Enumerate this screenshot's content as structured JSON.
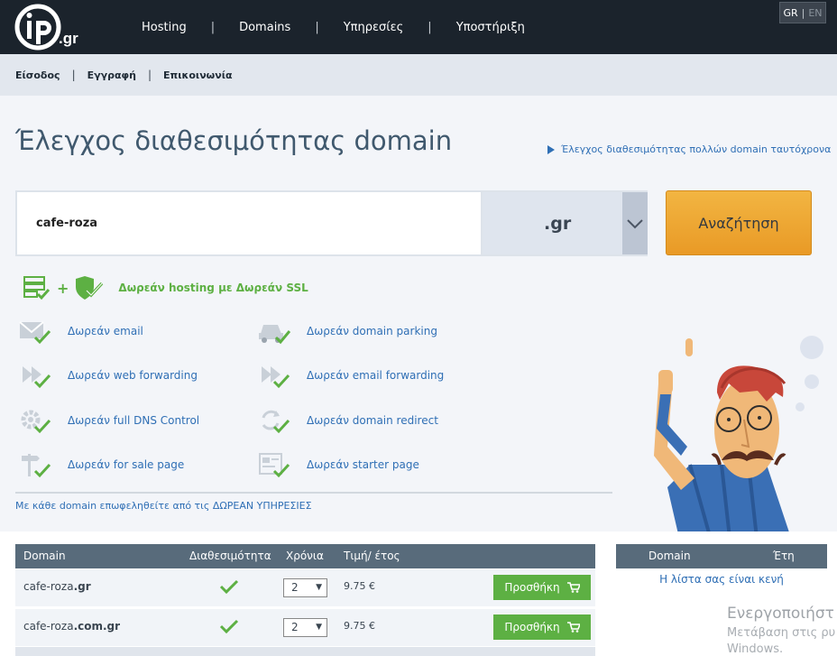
{
  "header": {
    "logo_text": "ip.gr",
    "nav": [
      "Hosting",
      "Domains",
      "Υπηρεσίες",
      "Υποστήριξη"
    ],
    "lang": {
      "active": "GR",
      "inactive": "EN"
    }
  },
  "subnav": [
    "Είσοδος",
    "Εγγραφή",
    "Επικοινωνία"
  ],
  "main": {
    "title": "Έλεγχος διαθεσιμότητας domain",
    "bulk_link": "Έλεγχος διαθεσιμότητας πολλών domain ταυτόχρονα"
  },
  "search": {
    "value": "cafe-roza",
    "tld": ".gr",
    "button": "Αναζήτηση"
  },
  "promo": "Δωρεάν hosting με Δωρεάν SSL",
  "features": [
    {
      "label": "Δωρεάν email",
      "icon": "envelope-icon"
    },
    {
      "label": "Δωρεάν domain parking",
      "icon": "car-icon"
    },
    {
      "label": "Δωρεάν web forwarding",
      "icon": "forward-icon"
    },
    {
      "label": "Δωρεάν email forwarding",
      "icon": "forward-icon"
    },
    {
      "label": "Δωρεάν full DNS Control",
      "icon": "gear-icon"
    },
    {
      "label": "Δωρεάν domain redirect",
      "icon": "redirect-icon"
    },
    {
      "label": "Δωρεάν for sale page",
      "icon": "signpost-icon"
    },
    {
      "label": "Δωρεάν starter page",
      "icon": "page-icon"
    }
  ],
  "note": "Με κάθε domain επωφεληθείτε από τις ΔΩΡΕΑΝ ΥΠΗΡΕΣΙΕΣ",
  "table": {
    "headers": [
      "Domain",
      "Διαθεσιμότητα",
      "Χρόνια",
      "Τιμή/ έτος"
    ],
    "rows": [
      {
        "name": "cafe-roza",
        "tld": ".gr",
        "years": "2",
        "price": "9.75 €",
        "button": "Προσθήκη"
      },
      {
        "name": "cafe-roza",
        "tld": ".com.gr",
        "years": "2",
        "price": "9.75 €",
        "button": "Προσθήκη"
      }
    ]
  },
  "cart": {
    "headers": [
      "Domain",
      "Έτη"
    ],
    "empty": "Η λίστα σας είναι κενή"
  },
  "watermark": {
    "line1": "Ενεργοποιήστ",
    "line2": "Μετάβαση στις ρυ",
    "line3": "Windows."
  },
  "colors": {
    "accent_green": "#5db043",
    "accent_orange": "#e99a26",
    "link_blue": "#2f6fb5",
    "dark_nav": "#1b232c"
  }
}
